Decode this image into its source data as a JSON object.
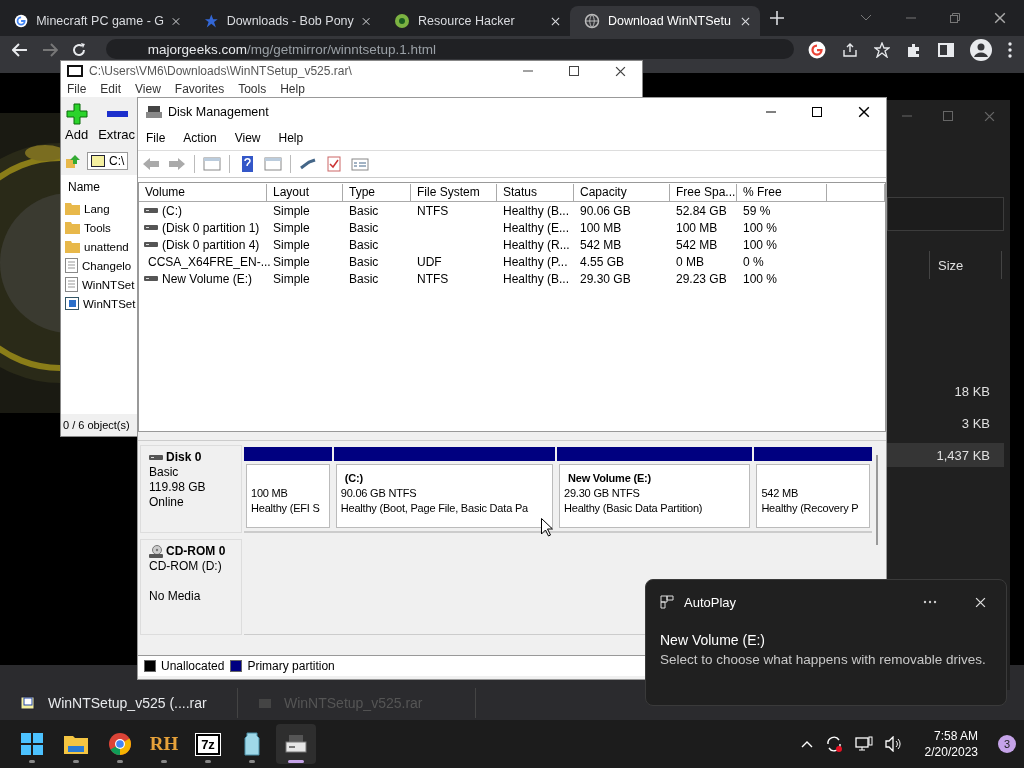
{
  "browser": {
    "tabs": [
      {
        "title": "Minecraft PC game - G",
        "selected": false
      },
      {
        "title": "Downloads - Bob Pony",
        "selected": false
      },
      {
        "title": "Resource Hacker",
        "selected": false
      },
      {
        "title": "Download WinNTSetu",
        "selected": true
      }
    ],
    "address": {
      "host": "majorgeeks.com",
      "path": "/mg/getmirror/winntsetup.1.html"
    },
    "downloads": [
      {
        "name": "WinNTSetup_v525 (....rar",
        "faded": false
      },
      {
        "name": "WinNTSetup_v525.rar",
        "faded": true
      }
    ]
  },
  "explorer_window": {
    "column": "Size",
    "rows": [
      {
        "size": "18 KB",
        "selected": false
      },
      {
        "size": "3 KB",
        "selected": false
      },
      {
        "size": "1,437 KB",
        "selected": true
      }
    ]
  },
  "sevenzip": {
    "title": "C:\\Users\\VM6\\Downloads\\WinNTSetup_v525.rar\\",
    "menu": [
      "File",
      "Edit",
      "View",
      "Favorites",
      "Tools",
      "Help"
    ],
    "toolbar": [
      {
        "label": "Add",
        "kind": "add"
      },
      {
        "label": "Extrac",
        "kind": "extract"
      }
    ],
    "path": "C:\\",
    "column": "Name",
    "items": [
      {
        "name": "Lang",
        "kind": "folder"
      },
      {
        "name": "Tools",
        "kind": "folder"
      },
      {
        "name": "unattend",
        "kind": "folder"
      },
      {
        "name": "Changelo",
        "kind": "text"
      },
      {
        "name": "WinNTSet",
        "kind": "text"
      },
      {
        "name": "WinNTSet",
        "kind": "app"
      }
    ],
    "status": "0 / 6 object(s)"
  },
  "disk_management": {
    "title": "Disk Management",
    "menu": [
      "File",
      "Action",
      "View",
      "Help"
    ],
    "columns": [
      "Volume",
      "Layout",
      "Type",
      "File System",
      "Status",
      "Capacity",
      "Free Spa...",
      "% Free"
    ],
    "rows": [
      {
        "kind": "disk",
        "cells": [
          " (C:)",
          "Simple",
          "Basic",
          "NTFS",
          "Healthy (B...",
          "90.06 GB",
          "52.84 GB",
          "59 %"
        ]
      },
      {
        "kind": "disk",
        "cells": [
          "(Disk 0 partition 1)",
          "Simple",
          "Basic",
          "",
          "Healthy (E...",
          "100 MB",
          "100 MB",
          "100 %"
        ]
      },
      {
        "kind": "disk",
        "cells": [
          "(Disk 0 partition 4)",
          "Simple",
          "Basic",
          "",
          "Healthy (R...",
          "542 MB",
          "542 MB",
          "100 %"
        ]
      },
      {
        "kind": "cd",
        "cells": [
          "CCSA_X64FRE_EN-...",
          "Simple",
          "Basic",
          "UDF",
          "Healthy (P...",
          "4.55 GB",
          "0 MB",
          "0 %"
        ]
      },
      {
        "kind": "disk",
        "cells": [
          "New Volume (E:)",
          "Simple",
          "Basic",
          "NTFS",
          "Healthy (B...",
          "29.30 GB",
          "29.23 GB",
          "100 %"
        ]
      }
    ],
    "disks": [
      {
        "kind": "disk",
        "name": "Disk 0",
        "type": "Basic",
        "size": "119.98 GB",
        "status": "Online",
        "partitions": [
          {
            "lines": [
              "100 MB",
              "Healthy (EFI S"
            ]
          },
          {
            "name": "(C:)",
            "lines": [
              "90.06 GB NTFS",
              "Healthy (Boot, Page File, Basic Data Pa"
            ]
          },
          {
            "name": "New Volume  (E:)",
            "lines": [
              "29.30 GB NTFS",
              "Healthy (Basic Data Partition)"
            ]
          },
          {
            "lines": [
              "542 MB",
              "Healthy (Recovery P"
            ]
          }
        ]
      },
      {
        "kind": "cd",
        "name": "CD-ROM 0",
        "type": "CD-ROM (D:)",
        "status": "No Media"
      }
    ],
    "legend": [
      {
        "label": "Unallocated",
        "color": "#000000"
      },
      {
        "label": "Primary partition",
        "color": "#000080"
      }
    ]
  },
  "autoplay": {
    "app": "AutoPlay",
    "title": "New Volume (E:)",
    "message": "Select to choose what happens with removable drives."
  },
  "taskbar": {
    "apps": [
      {
        "kind": "start",
        "selected": false
      },
      {
        "kind": "folder",
        "selected": false
      },
      {
        "kind": "chrome",
        "selected": false
      },
      {
        "kind": "text",
        "label": "RH",
        "selected": false
      },
      {
        "kind": "boxed",
        "label": "7z",
        "selected": false
      },
      {
        "kind": "bottle",
        "selected": false
      },
      {
        "kind": "disk",
        "selected": true
      }
    ],
    "time": "7:58 AM",
    "date": "2/20/2023",
    "badge": "3"
  }
}
